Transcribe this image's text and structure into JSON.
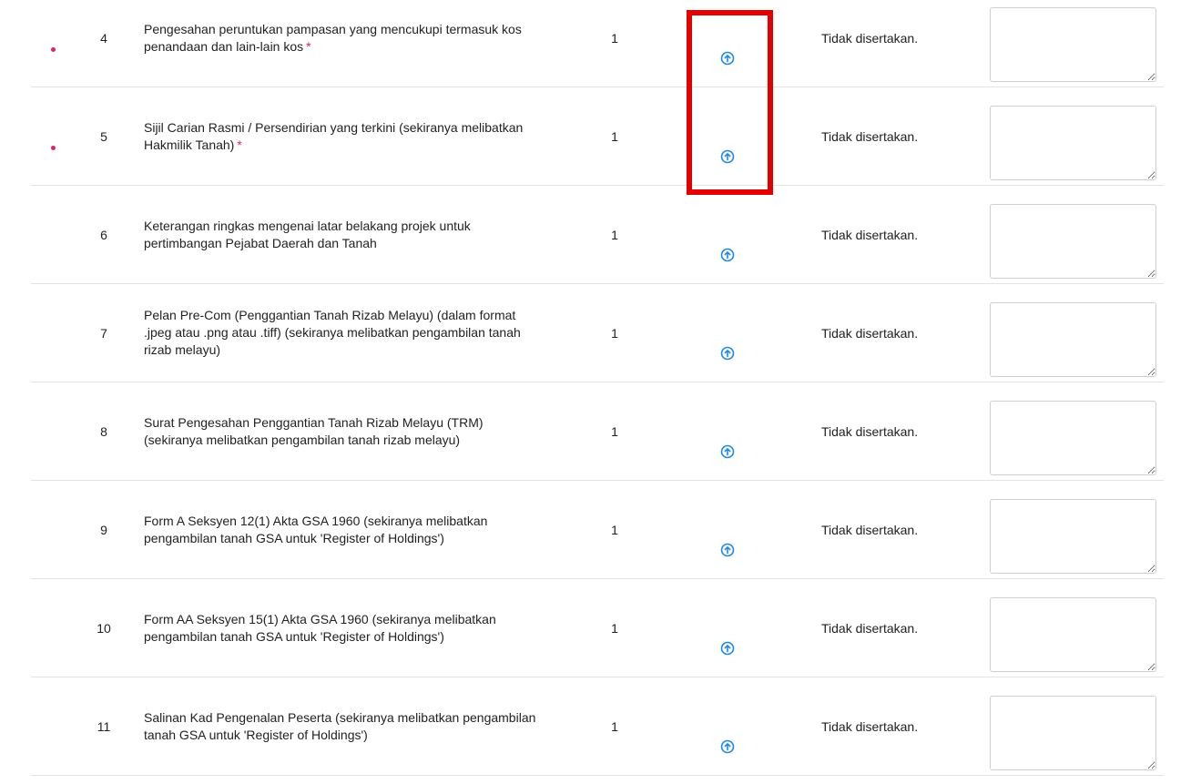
{
  "accent_color": "#1e88e5",
  "required_color": "#e0245e",
  "highlight_color": "#e30000",
  "upload_icon": "arrow-up-circle-icon",
  "rows": [
    {
      "number": "4",
      "required": true,
      "description": "Pengesahan peruntukan pampasan yang mencukupi termasuk kos penandaan dan lain-lain kos",
      "required_mark": "*",
      "quantity": "1",
      "status": "Tidak disertakan.",
      "remark": ""
    },
    {
      "number": "5",
      "required": true,
      "description": "Sijil Carian Rasmi / Persendirian yang terkini (sekiranya melibatkan Hakmilik Tanah)",
      "required_mark": "*",
      "quantity": "1",
      "status": "Tidak disertakan.",
      "remark": ""
    },
    {
      "number": "6",
      "required": false,
      "description": "Keterangan ringkas mengenai latar belakang projek untuk pertimbangan Pejabat Daerah dan Tanah",
      "required_mark": "",
      "quantity": "1",
      "status": "Tidak disertakan.",
      "remark": ""
    },
    {
      "number": "7",
      "required": false,
      "description": "Pelan Pre-Com (Penggantian Tanah Rizab Melayu) (dalam format .jpeg atau .png atau .tiff) (sekiranya melibatkan pengambilan tanah rizab melayu)",
      "required_mark": "",
      "quantity": "1",
      "status": "Tidak disertakan.",
      "remark": ""
    },
    {
      "number": "8",
      "required": false,
      "description": "Surat Pengesahan Penggantian Tanah Rizab Melayu (TRM) (sekiranya melibatkan pengambilan tanah rizab melayu)",
      "required_mark": "",
      "quantity": "1",
      "status": "Tidak disertakan.",
      "remark": ""
    },
    {
      "number": "9",
      "required": false,
      "description": "Form A Seksyen 12(1) Akta GSA 1960 (sekiranya melibatkan pengambilan tanah GSA untuk  'Register of Holdings')",
      "required_mark": "",
      "quantity": "1",
      "status": "Tidak disertakan.",
      "remark": ""
    },
    {
      "number": "10",
      "required": false,
      "description": "Form AA Seksyen 15(1) Akta GSA 1960 (sekiranya melibatkan pengambilan tanah GSA untuk 'Register of Holdings')",
      "required_mark": "",
      "quantity": "1",
      "status": "Tidak disertakan.",
      "remark": ""
    },
    {
      "number": "11",
      "required": false,
      "description": "Salinan Kad Pengenalan Peserta (sekiranya melibatkan pengambilan tanah GSA untuk 'Register of Holdings')",
      "required_mark": "",
      "quantity": "1",
      "status": "Tidak disertakan.",
      "remark": ""
    }
  ]
}
